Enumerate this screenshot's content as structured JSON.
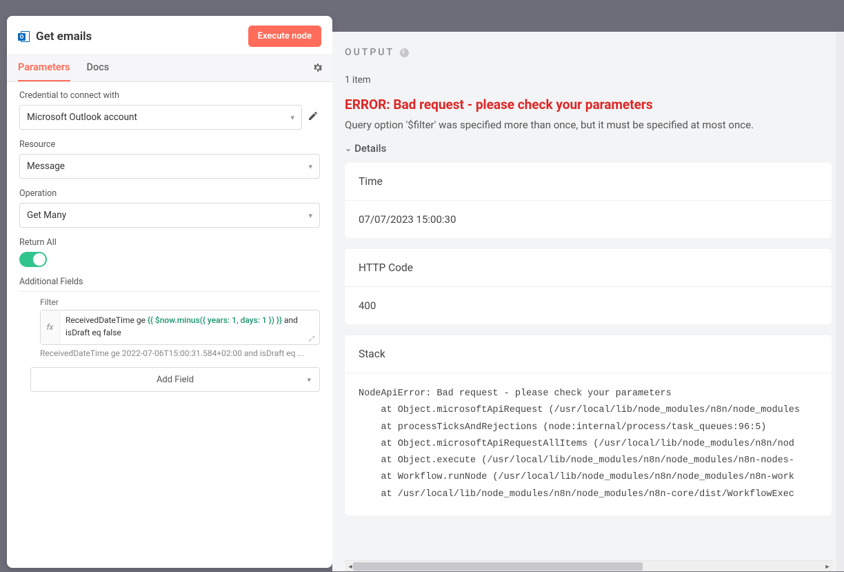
{
  "header": {
    "title": "Get emails",
    "execute_label": "Execute node"
  },
  "tabs": {
    "parameters": "Parameters",
    "docs": "Docs"
  },
  "fields": {
    "credential": {
      "label": "Credential to connect with",
      "value": "Microsoft Outlook account"
    },
    "resource": {
      "label": "Resource",
      "value": "Message"
    },
    "operation": {
      "label": "Operation",
      "value": "Get Many"
    },
    "return_all": {
      "label": "Return All"
    },
    "additional_title": "Additional Fields",
    "filter": {
      "label": "Filter",
      "prefix": "ReceivedDateTime ge ",
      "expr": "{{ $now.minus({ years: 1, days: 1 }) }}",
      "suffix": " and isDraft eq false",
      "resolved": "ReceivedDateTime ge 2022-07-06T15:00:31.584+02:00 and isDraft eq ..."
    },
    "add_field": "Add Field"
  },
  "output": {
    "heading": "OUTPUT",
    "item_count": "1 item",
    "error_title": "ERROR: Bad request - please check your parameters",
    "error_sub": "Query option '$filter' was specified more than once, but it must be specified at most once.",
    "details_label": "Details",
    "cards": {
      "time": {
        "header": "Time",
        "value": "07/07/2023 15:00:30"
      },
      "http": {
        "header": "HTTP Code",
        "value": "400"
      },
      "stack": {
        "header": "Stack",
        "value": "NodeApiError: Bad request - please check your parameters\n    at Object.microsoftApiRequest (/usr/local/lib/node_modules/n8n/node_modules\n    at processTicksAndRejections (node:internal/process/task_queues:96:5)\n    at Object.microsoftApiRequestAllItems (/usr/local/lib/node_modules/n8n/nod\n    at Object.execute (/usr/local/lib/node_modules/n8n/node_modules/n8n-nodes-\n    at Workflow.runNode (/usr/local/lib/node_modules/n8n/node_modules/n8n-work\n    at /usr/local/lib/node_modules/n8n/node_modules/n8n-core/dist/WorkflowExec"
      }
    }
  }
}
